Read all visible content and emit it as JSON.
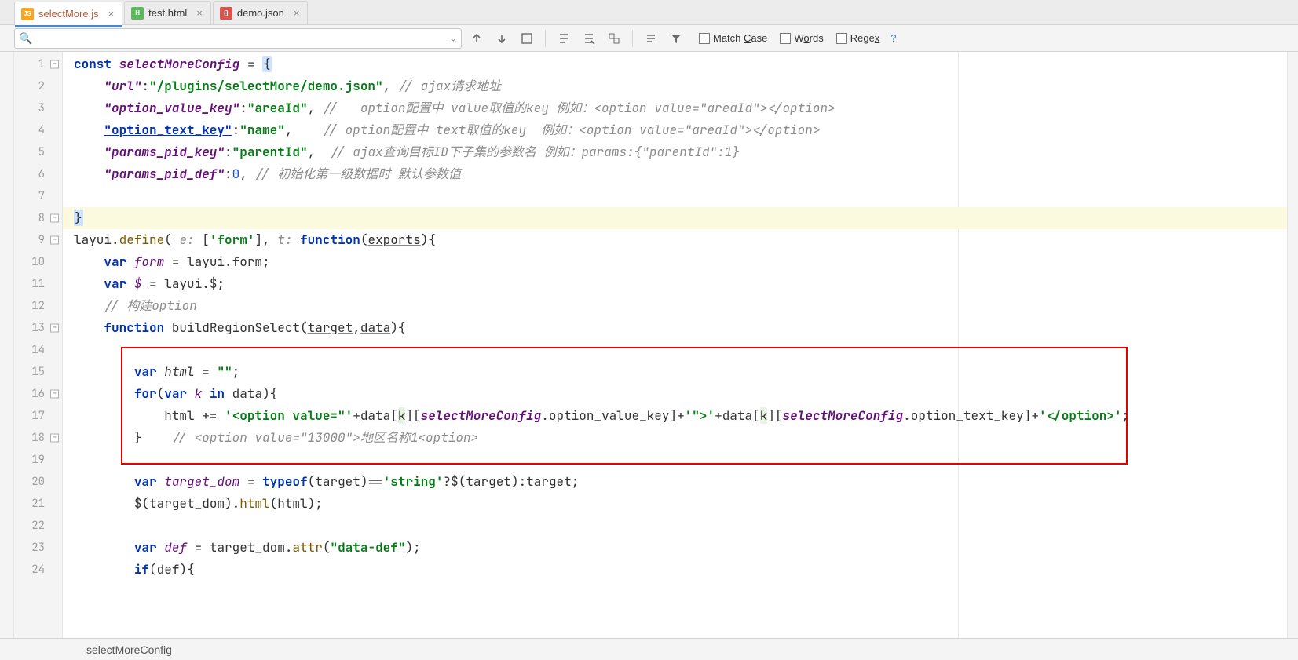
{
  "tabs": [
    {
      "label": "selectMore.js",
      "icon": "JS",
      "active": true
    },
    {
      "label": "test.html",
      "icon": "H",
      "active": false
    },
    {
      "label": "demo.json",
      "icon": "{}",
      "active": false
    }
  ],
  "find": {
    "value": "",
    "placeholder": "",
    "match_case": "Match Case",
    "words": "Words",
    "regex": "Regex",
    "help": "?"
  },
  "gutter_lines": [
    "1",
    "2",
    "3",
    "4",
    "5",
    "6",
    "7",
    "8",
    "9",
    "10",
    "11",
    "12",
    "13",
    "14",
    "15",
    "16",
    "17",
    "18",
    "19",
    "20",
    "21",
    "22",
    "23",
    "24"
  ],
  "code": {
    "l1": {
      "kw": "const",
      "id": "selectMoreConfig",
      "eq": " = ",
      "brace": "{"
    },
    "l2": {
      "key": "\"url\"",
      "colon": ":",
      "val": "\"/plugins/selectMore/demo.json\"",
      "comma": ",",
      "cmt": " // ajax请求地址"
    },
    "l3": {
      "key": "\"option_value_key\"",
      "colon": ":",
      "val": "\"areaId\"",
      "comma": ",",
      "cmt": " //   option配置中 value取值的key 例如：<option value=\"areaId\"></option>"
    },
    "l4": {
      "key": "\"option_text_key\"",
      "colon": ":",
      "val": "\"name\"",
      "comma": ",",
      "cmt": "    // option配置中 text取值的key  例如：<option value=\"areaId\"></option>"
    },
    "l5": {
      "key": "\"params_pid_key\"",
      "colon": ":",
      "val": "\"parentId\"",
      "comma": ",",
      "cmt": "  // ajax查询目标ID下子集的参数名 例如：params:{\"parentId\":1}"
    },
    "l6": {
      "key": "\"params_pid_def\"",
      "colon": ":",
      "val": "0",
      "comma": ",",
      "cmt": " // 初始化第一级数据时 默认参数值"
    },
    "l7": "",
    "l8": {
      "brace": "}"
    },
    "l9": {
      "obj": "layui",
      "dot1": ".",
      "fn": "define",
      "open": "( ",
      "hint1": "e:",
      "arg1a": " [",
      "arg1b": "'form'",
      "arg1c": "], ",
      "hint2": "t:",
      "kw": " function",
      "open2": "(",
      "p": "exports",
      "close": "){"
    },
    "l10": {
      "kw": "var",
      "id": "form",
      "rest": " = layui.form;"
    },
    "l11": {
      "kw": "var",
      "id": "$",
      "rest": " = layui.$;"
    },
    "l12": {
      "cmt": "// 构建option"
    },
    "l13": {
      "kw": "function",
      "fn": " buildRegionSelect(",
      "p1": "target",
      "comma": ",",
      "p2": "data",
      "close": "){"
    },
    "l14": "",
    "l15": {
      "kw": "var",
      "id": "html",
      "rest": " = ",
      "val": "\"\"",
      "semi": ";"
    },
    "l16": {
      "kw": "for",
      "open": "(",
      "kw2": "var",
      "id": " k ",
      "kw3": "in",
      "p": " data",
      "close": "){"
    },
    "l17": {
      "id": "html",
      "op": " += ",
      "s1": "'<option value=\"'",
      "plus1": "+",
      "d1": "data",
      "br1": "[",
      "k1": "k",
      "br2": "][",
      "cfg1": "selectMoreConfig",
      "dot1": ".option_value_key]+",
      "s2": "'\">'",
      "plus2": "+",
      "d2": "data",
      "br3": "[",
      "k2": "k",
      "br4": "][",
      "cfg2": "selectMoreConfig",
      "dot2": ".option_text_key]+",
      "s3": "'</option>'",
      "semi": ";"
    },
    "l18": {
      "brace": "}",
      "cmt": "    // <option value=\"13000\">地区名称1<option>"
    },
    "l19": "",
    "l20": {
      "kw": "var",
      "id": "target_dom",
      "eq": " = ",
      "kw2": "typeof",
      "open": "(",
      "p1": "target",
      "mid": ")==",
      "s": "'string'",
      "q": "?$(",
      "p2": "target",
      "mid2": "):",
      "p3": "target",
      "semi": ";"
    },
    "l21": {
      "text": "$(target_dom).",
      "fn": "html",
      "open": "(html);"
    },
    "l22": "",
    "l23": {
      "kw": "var",
      "id": "def",
      "eq": " = target_dom.",
      "fn": "attr",
      "open": "(",
      "s": "\"data-def\"",
      "close": ");"
    },
    "l24": {
      "kw": "if",
      "open": "(def){"
    }
  },
  "breadcrumb": "selectMoreConfig"
}
